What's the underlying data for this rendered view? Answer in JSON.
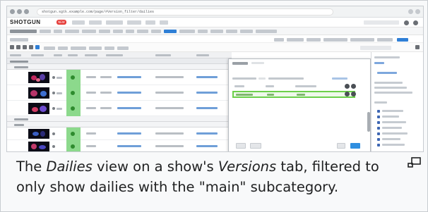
{
  "screenshot": {
    "url": "shotgun.sgtk.example.com/page/#Version_filter/dailies",
    "logo": "SHOTGUN",
    "badge": "NEW",
    "colors": {
      "highlight_border": "#6cd04a",
      "status_green": "#8cd98c",
      "accent_blue": "#2f7fd6",
      "thumb_bg": "#0b0b16"
    }
  },
  "caption": {
    "part1": "The ",
    "view_name": "Dailies",
    "part2": " view on a show's ",
    "tab_name": "Versions",
    "part3": " tab, filtered to only show dailies with the \"main\" subcategory."
  },
  "icons": {
    "magnify": "enlarge-icon"
  }
}
